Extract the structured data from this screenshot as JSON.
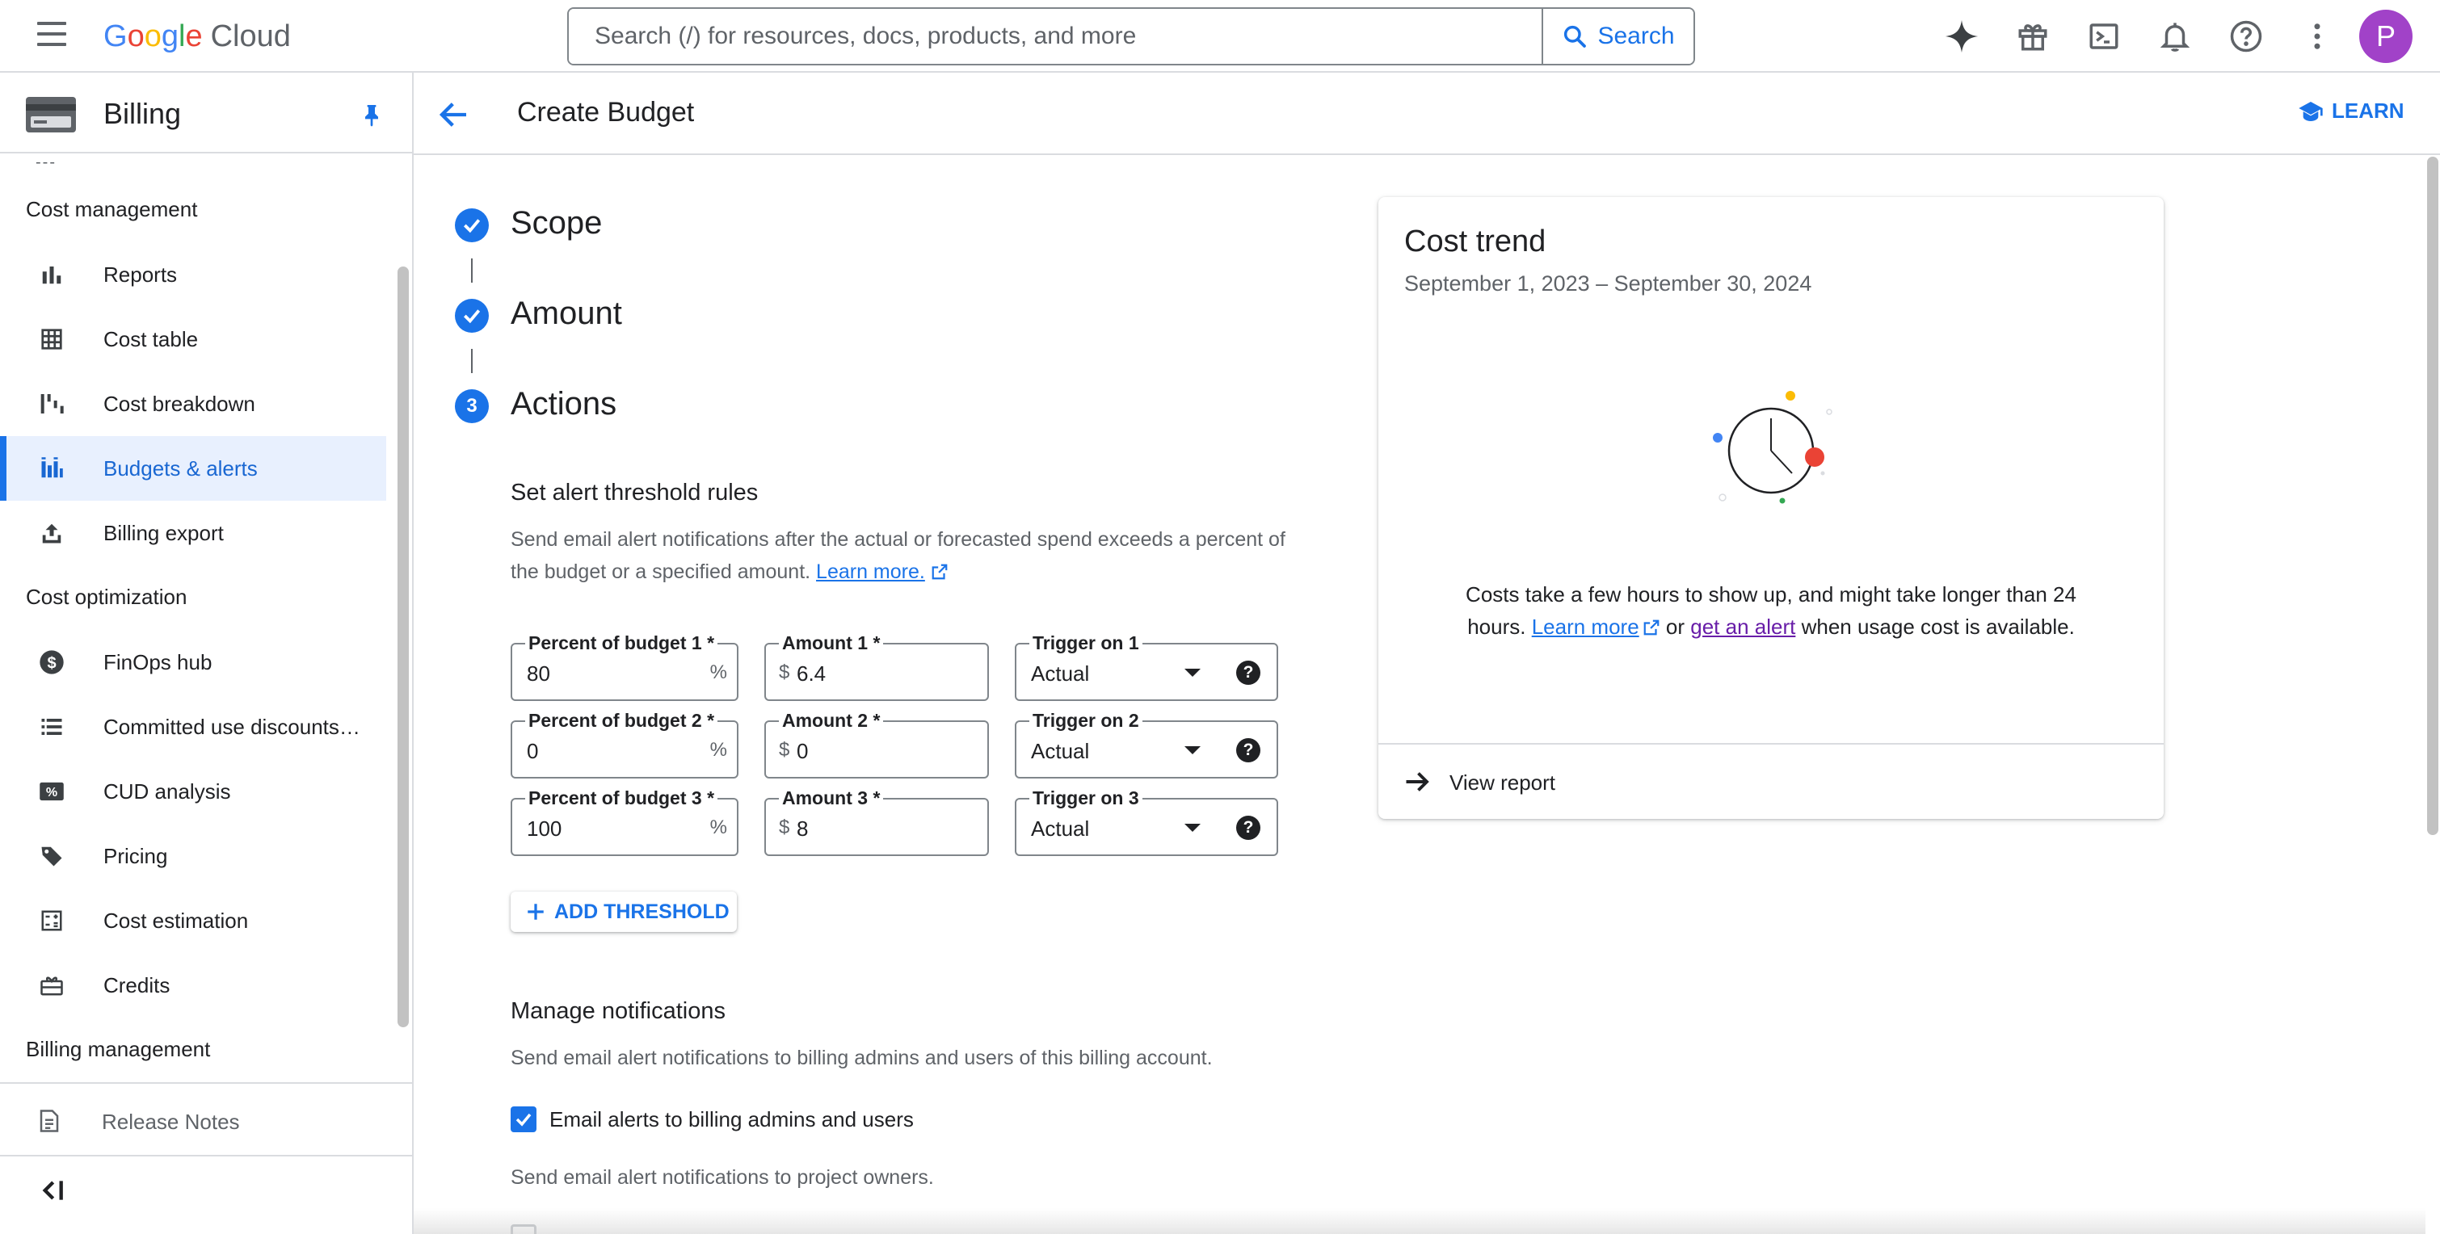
{
  "topbar": {
    "logo_google": "Google",
    "logo_cloud": "Cloud",
    "search_placeholder": "Search (/) for resources, docs, products, and more",
    "search_button": "Search",
    "avatar_letter": "P"
  },
  "sidebar": {
    "title": "Billing",
    "dots": "---",
    "section_cost_management": "Cost management",
    "section_cost_optimization": "Cost optimization",
    "section_billing_management": "Billing management",
    "items": {
      "reports": "Reports",
      "cost_table": "Cost table",
      "cost_breakdown": "Cost breakdown",
      "budgets_alerts": "Budgets & alerts",
      "billing_export": "Billing export",
      "finops_hub": "FinOps hub",
      "committed_use": "Committed use discounts…",
      "cud_analysis": "CUD analysis",
      "pricing": "Pricing",
      "cost_estimation": "Cost estimation",
      "credits": "Credits"
    },
    "release_notes": "Release Notes"
  },
  "header": {
    "title": "Create Budget",
    "learn": "LEARN"
  },
  "stepper": {
    "step1": "Scope",
    "step2": "Amount",
    "step3": "Actions",
    "step3_number": "3"
  },
  "thresholds": {
    "title": "Set alert threshold rules",
    "desc_line1": "Send email alert notifications after the actual or forecasted spend exceeds a percent of",
    "desc_line2": "the budget or a specified amount.",
    "learn_more": "Learn more.",
    "percent_suffix": "%",
    "currency_prefix": "$",
    "rows": [
      {
        "percent_label": "Percent of budget 1 *",
        "percent": "80",
        "amount_label": "Amount 1 *",
        "amount": "6.4",
        "trigger_label": "Trigger on 1",
        "trigger": "Actual"
      },
      {
        "percent_label": "Percent of budget 2 *",
        "percent": "0",
        "amount_label": "Amount 2 *",
        "amount": "0",
        "trigger_label": "Trigger on 2",
        "trigger": "Actual"
      },
      {
        "percent_label": "Percent of budget 3 *",
        "percent": "100",
        "amount_label": "Amount 3 *",
        "amount": "8",
        "trigger_label": "Trigger on 3",
        "trigger": "Actual"
      }
    ],
    "help_glyph": "?",
    "add_button": "ADD THRESHOLD"
  },
  "notifications": {
    "title": "Manage notifications",
    "desc1": "Send email alert notifications to billing admins and users of this billing account.",
    "checkbox1": "Email alerts to billing admins and users",
    "checkbox1_checked": true,
    "desc2": "Send email alert notifications to project owners."
  },
  "cost_trend": {
    "title": "Cost trend",
    "range": "September 1, 2023 – September 30, 2024",
    "msg_part1": "Costs take a few hours to show up, and might take longer than 24 hours.",
    "learn_more": "Learn more",
    "msg_or": "or",
    "get_alert": "get an alert",
    "msg_part2": "when usage cost is available.",
    "view_report": "View report"
  },
  "colors": {
    "accent": "#1a73e8",
    "active_bg": "#e8f0fe",
    "avatar": "#a142c8",
    "visited_link": "#681da8"
  }
}
